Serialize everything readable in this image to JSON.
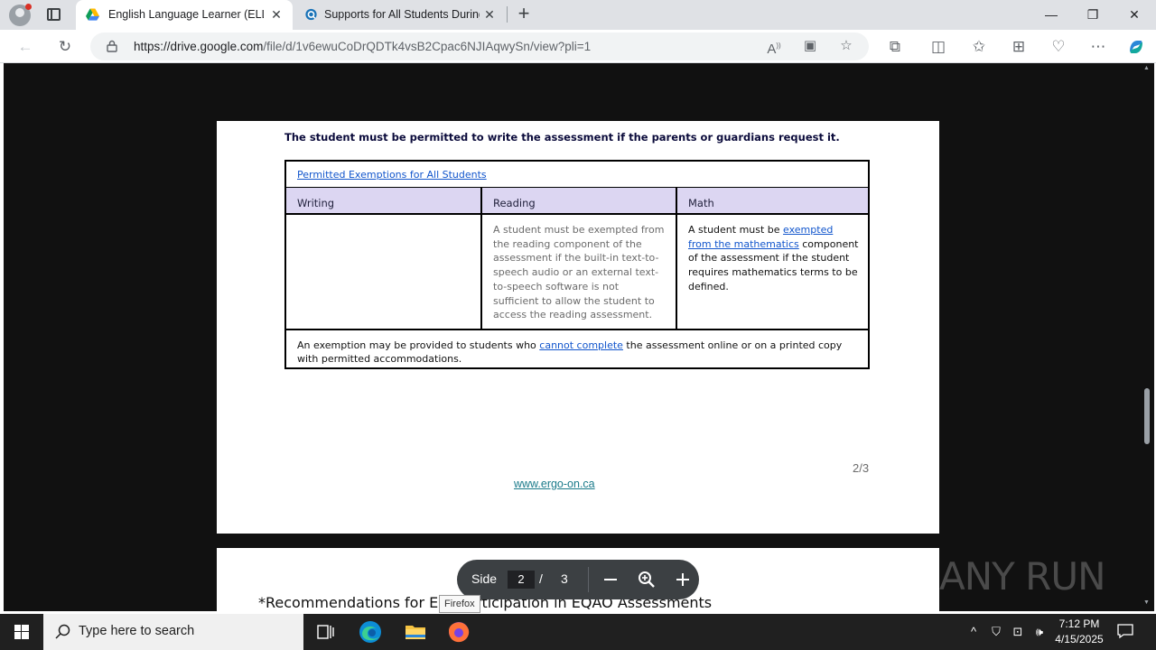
{
  "browser": {
    "tabs": [
      {
        "title": "English Language Learner (ELL) P",
        "favicon": "google-drive-icon"
      },
      {
        "title": "Supports for All Students During",
        "favicon": "q-icon"
      }
    ],
    "url_host": "https://drive.google.com",
    "url_path": "/file/d/1v6ewuCoDrQDTk4vsB2Cpac6NJIAqwySn/view?pli=1"
  },
  "document": {
    "note": "The student must be permitted to write the assessment if the parents or guardians request it.",
    "table": {
      "caption": "Permitted Exemptions for All Students",
      "headers": [
        "Writing",
        "Reading",
        "Math"
      ],
      "writing_cell": "",
      "reading_cell": "A student must be exempted from the reading component of the assessment if the built-in text-to-speech audio or an external text-to-speech software is not sufficient to allow the student to access the reading assessment.",
      "math_before": "A student must be ",
      "math_link": "exempted from the mathematics",
      "math_after": " component of the assessment if the student requires mathematics terms to be defined.",
      "footer_before": "An exemption may be provided to students who ",
      "footer_link": "cannot complete",
      "footer_after": " the assessment online or on a printed copy with permitted accommodations."
    },
    "page_number": "2/3",
    "site_link": "www.ergo-on.ca",
    "next_page_title": "*Recommendations for ELL Participation in EQAO Assessments"
  },
  "pager": {
    "label": "Side",
    "current": "2",
    "separator": "/",
    "total": "3"
  },
  "watermark": "ANY RUN",
  "tooltip": "Firefox",
  "taskbar": {
    "search_placeholder": "Type here to search",
    "time": "7:12 PM",
    "date": "4/15/2025"
  },
  "colors": {
    "table_header_bg": "#dcd6f2",
    "link": "#1155cc",
    "viewer_bg": "#111111"
  }
}
